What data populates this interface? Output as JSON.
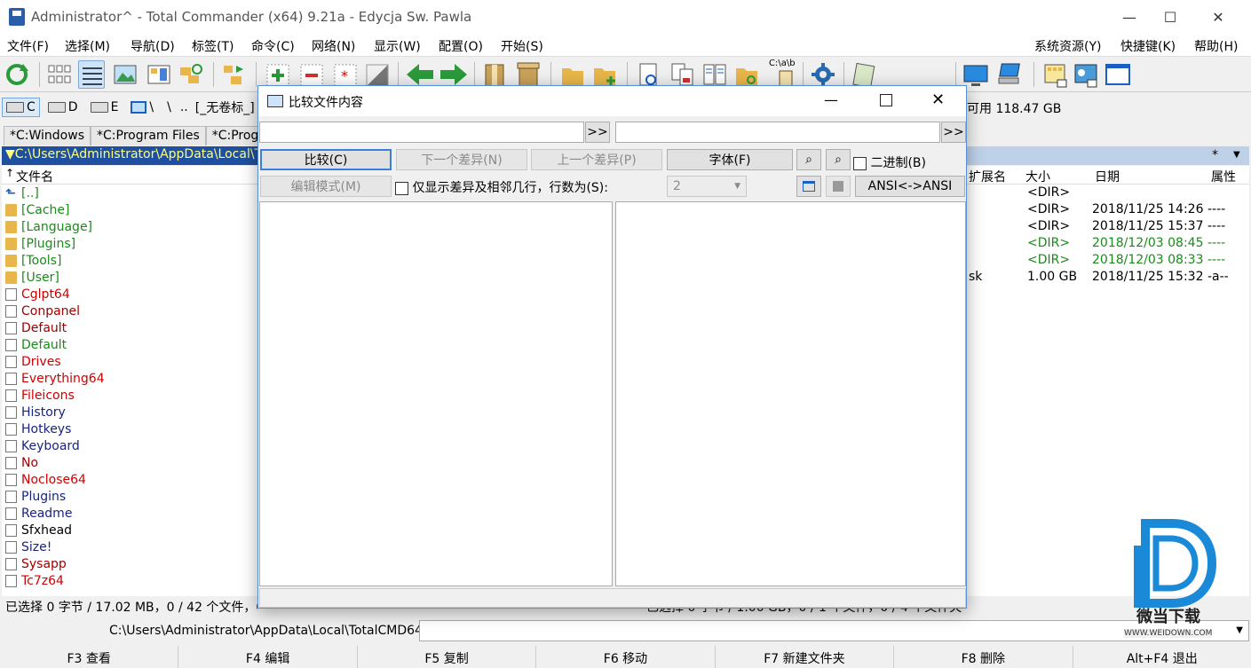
{
  "window": {
    "title": "Administrator^ - Total Commander (x64) 9.21a - Edycja Sw. Pawla",
    "min_glyph": "—",
    "max_glyph": "☐",
    "close_glyph": "✕"
  },
  "menu": {
    "left": [
      "文件(F)",
      "选择(M)",
      "导航(D)",
      "标签(T)",
      "命令(C)",
      "网络(N)",
      "显示(W)",
      "配置(O)",
      "开始(S)"
    ],
    "right": [
      "系统资源(Y)",
      "快捷键(K)",
      "帮助(H)"
    ]
  },
  "toolbar": {
    "path_hint": "C:\\a\\b"
  },
  "drives": {
    "items": [
      "C",
      "D",
      "E"
    ],
    "net": "\\",
    "root": "\\",
    "up": "..",
    "volume": "[_无卷标_]",
    "free_space": "可用 118.47 GB"
  },
  "left_panel": {
    "tabs": [
      "*C:Windows",
      "*C:Program Files",
      "*C:Program"
    ],
    "path": "C:\\Users\\Administrator\\AppData\\Local\\TotalCMD64\\*.*",
    "col_name": "文件名",
    "sort_arrow": "↑",
    "up_label": "[..]",
    "files": [
      {
        "name": "[Cache]",
        "color": "#1a8a1a",
        "type": "folder"
      },
      {
        "name": "[Language]",
        "color": "#1a8a1a",
        "type": "folder"
      },
      {
        "name": "[Plugins]",
        "color": "#1a8a1a",
        "type": "folder"
      },
      {
        "name": "[Tools]",
        "color": "#1a8a1a",
        "type": "folder"
      },
      {
        "name": "[User]",
        "color": "#1a8a1a",
        "type": "folder"
      },
      {
        "name": "Cglpt64",
        "color": "#d00000",
        "type": "doc"
      },
      {
        "name": "Conpanel",
        "color": "#a00000",
        "type": "doc"
      },
      {
        "name": "Default",
        "color": "#a00000",
        "type": "doc"
      },
      {
        "name": "Default",
        "color": "#1a8a1a",
        "type": "doc"
      },
      {
        "name": "Drives",
        "color": "#d00000",
        "type": "doc"
      },
      {
        "name": "Everything64",
        "color": "#d00000",
        "type": "doc"
      },
      {
        "name": "Fileicons",
        "color": "#d00000",
        "type": "doc"
      },
      {
        "name": "History",
        "color": "#1a237e",
        "type": "doc"
      },
      {
        "name": "Hotkeys",
        "color": "#1a237e",
        "type": "doc"
      },
      {
        "name": "Keyboard",
        "color": "#1a237e",
        "type": "doc"
      },
      {
        "name": "No",
        "color": "#a00000",
        "type": "doc"
      },
      {
        "name": "Noclose64",
        "color": "#d00000",
        "type": "doc"
      },
      {
        "name": "Plugins",
        "color": "#1a237e",
        "type": "doc"
      },
      {
        "name": "Readme",
        "color": "#1a237e",
        "type": "doc"
      },
      {
        "name": "Sfxhead",
        "color": "#000000",
        "type": "doc"
      },
      {
        "name": "Size!",
        "color": "#1a237e",
        "type": "doc"
      },
      {
        "name": "Sysapp",
        "color": "#a00000",
        "type": "doc"
      },
      {
        "name": "Tc7z64",
        "color": "#d00000",
        "type": "doc"
      }
    ],
    "status": "已选择 0 字节 / 17.02 MB，0 / 42 个文件，0 / 5 个文件夹"
  },
  "right_panel": {
    "star": "*",
    "dropdown": "▼",
    "col_ext": "扩展名",
    "col_size": "大小",
    "col_date": "日期",
    "col_attr": "属性",
    "rows": [
      {
        "ext": "",
        "size": "<DIR>",
        "date": "",
        "attr": "",
        "color": "#000000"
      },
      {
        "ext": "",
        "size": "<DIR>",
        "date": "2018/11/25 14:26",
        "attr": "----",
        "color": "#000000"
      },
      {
        "ext": "",
        "size": "<DIR>",
        "date": "2018/11/25 15:37",
        "attr": "----",
        "color": "#000000"
      },
      {
        "ext": "",
        "size": "<DIR>",
        "date": "2018/12/03 08:45",
        "attr": "----",
        "color": "#1a8a1a"
      },
      {
        "ext": "",
        "size": "<DIR>",
        "date": "2018/12/03 08:33",
        "attr": "----",
        "color": "#1a8a1a"
      },
      {
        "ext": "sk",
        "size": "1.00 GB",
        "date": "2018/11/25 15:32",
        "attr": "-a--",
        "color": "#000000"
      }
    ],
    "status": "已选择 0 字节 / 1.00 GB，0 / 1 个文件，0 / 4 个文件夹"
  },
  "cmdline": {
    "prompt": "C:\\Users\\Administrator\\AppData\\Local\\TotalCMD64>",
    "value": ""
  },
  "fkeys": [
    "F3 查看",
    "F4 编辑",
    "F5 复制",
    "F6 移动",
    "F7 新建文件夹",
    "F8 删除",
    "Alt+F4 退出"
  ],
  "dialog": {
    "title": "比较文件内容",
    "browse": ">>",
    "left_file": "",
    "right_file": "",
    "compare": "比较(C)",
    "next_diff": "下一个差异(N)",
    "prev_diff": "上一个差异(P)",
    "font": "字体(F)",
    "binary": "二进制(B)",
    "edit_mode": "编辑模式(M)",
    "only_diff": "仅显示差异及相邻几行，行数为(S):",
    "lines": "2",
    "encoding": "ANSI<->ANSI"
  },
  "watermark": {
    "text": "微当下载",
    "url": "WWW.WEIDOWN.COM"
  }
}
